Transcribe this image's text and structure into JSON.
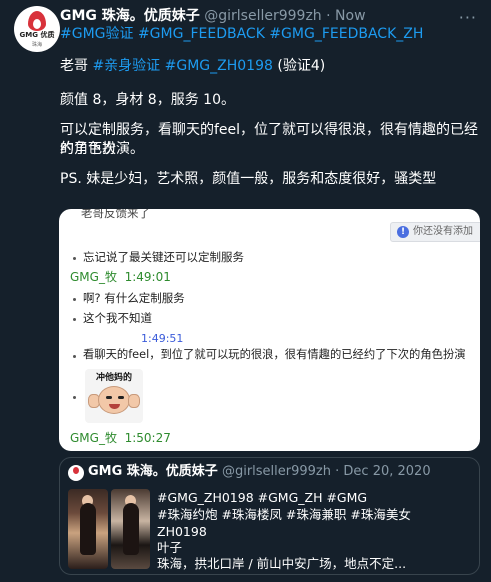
{
  "tweet": {
    "author_name": "GMG 珠海。优质妹子",
    "author_handle": "@girlseller999zh",
    "separator": " · ",
    "time": "Now",
    "more": "···",
    "avatar_text": "GMG 优质",
    "avatar_subtext": "珠海",
    "hashtags": "#GMG验证 #GMG_FEEDBACK #GMG_FEEDBACK_ZH",
    "line1": {
      "prefix": "老哥 ",
      "tag1": "#亲身验证",
      "space": " ",
      "tag2": "#GMG_ZH0198",
      "suffix": " (验证4)"
    },
    "ratings": "颜值 8，身材 8，服务 10。",
    "desc_line1": "可以定制服务，看聊天的feel，位了就可以得很浪，很有情趣的已经约了下次",
    "desc_line2": "的角色扮演。",
    "ps": "PS. 妹是少妇，艺术照，颜值一般，服务和态度很好，骚类型"
  },
  "screenshot": {
    "top_cut": "老哥反馈来了",
    "not_friend": "你还没有添加",
    "not_friend_icon": "!",
    "msg1": "忘记说了最关键还可以定制服务",
    "sender1": "GMG_牧",
    "time1": "1:49:01",
    "msg2": "啊? 有什么定制服务",
    "msg3": "这个我不知道",
    "time2": "1:49:51",
    "msg4": "看聊天的feel，到位了就可以玩的很浪，很有情趣的已经约了下次的角色扮演",
    "sticker_caption": "冲他妈的",
    "sender2": "GMG_牧",
    "time3": "1:50:27"
  },
  "quote": {
    "author_name": "GMG 珠海。优质妹子",
    "author_handle": "@girlseller999zh",
    "separator": " · ",
    "date": "Dec 20, 2020",
    "line1": "#GMG_ZH0198 #GMG_ZH  #GMG",
    "line2": "#珠海约炮 #珠海楼凤 #珠海兼职  #珠海美女",
    "line3": "ZH0198",
    "line4": "叶子",
    "line5": "珠海，拱北口岸 / 前山中安广场，地点不定..."
  },
  "colors": {
    "background": "#15202b",
    "link": "#1d9bf0",
    "muted": "#8899a6",
    "chat_green": "#2e8b2e",
    "chat_blue": "#3a5bd9"
  }
}
